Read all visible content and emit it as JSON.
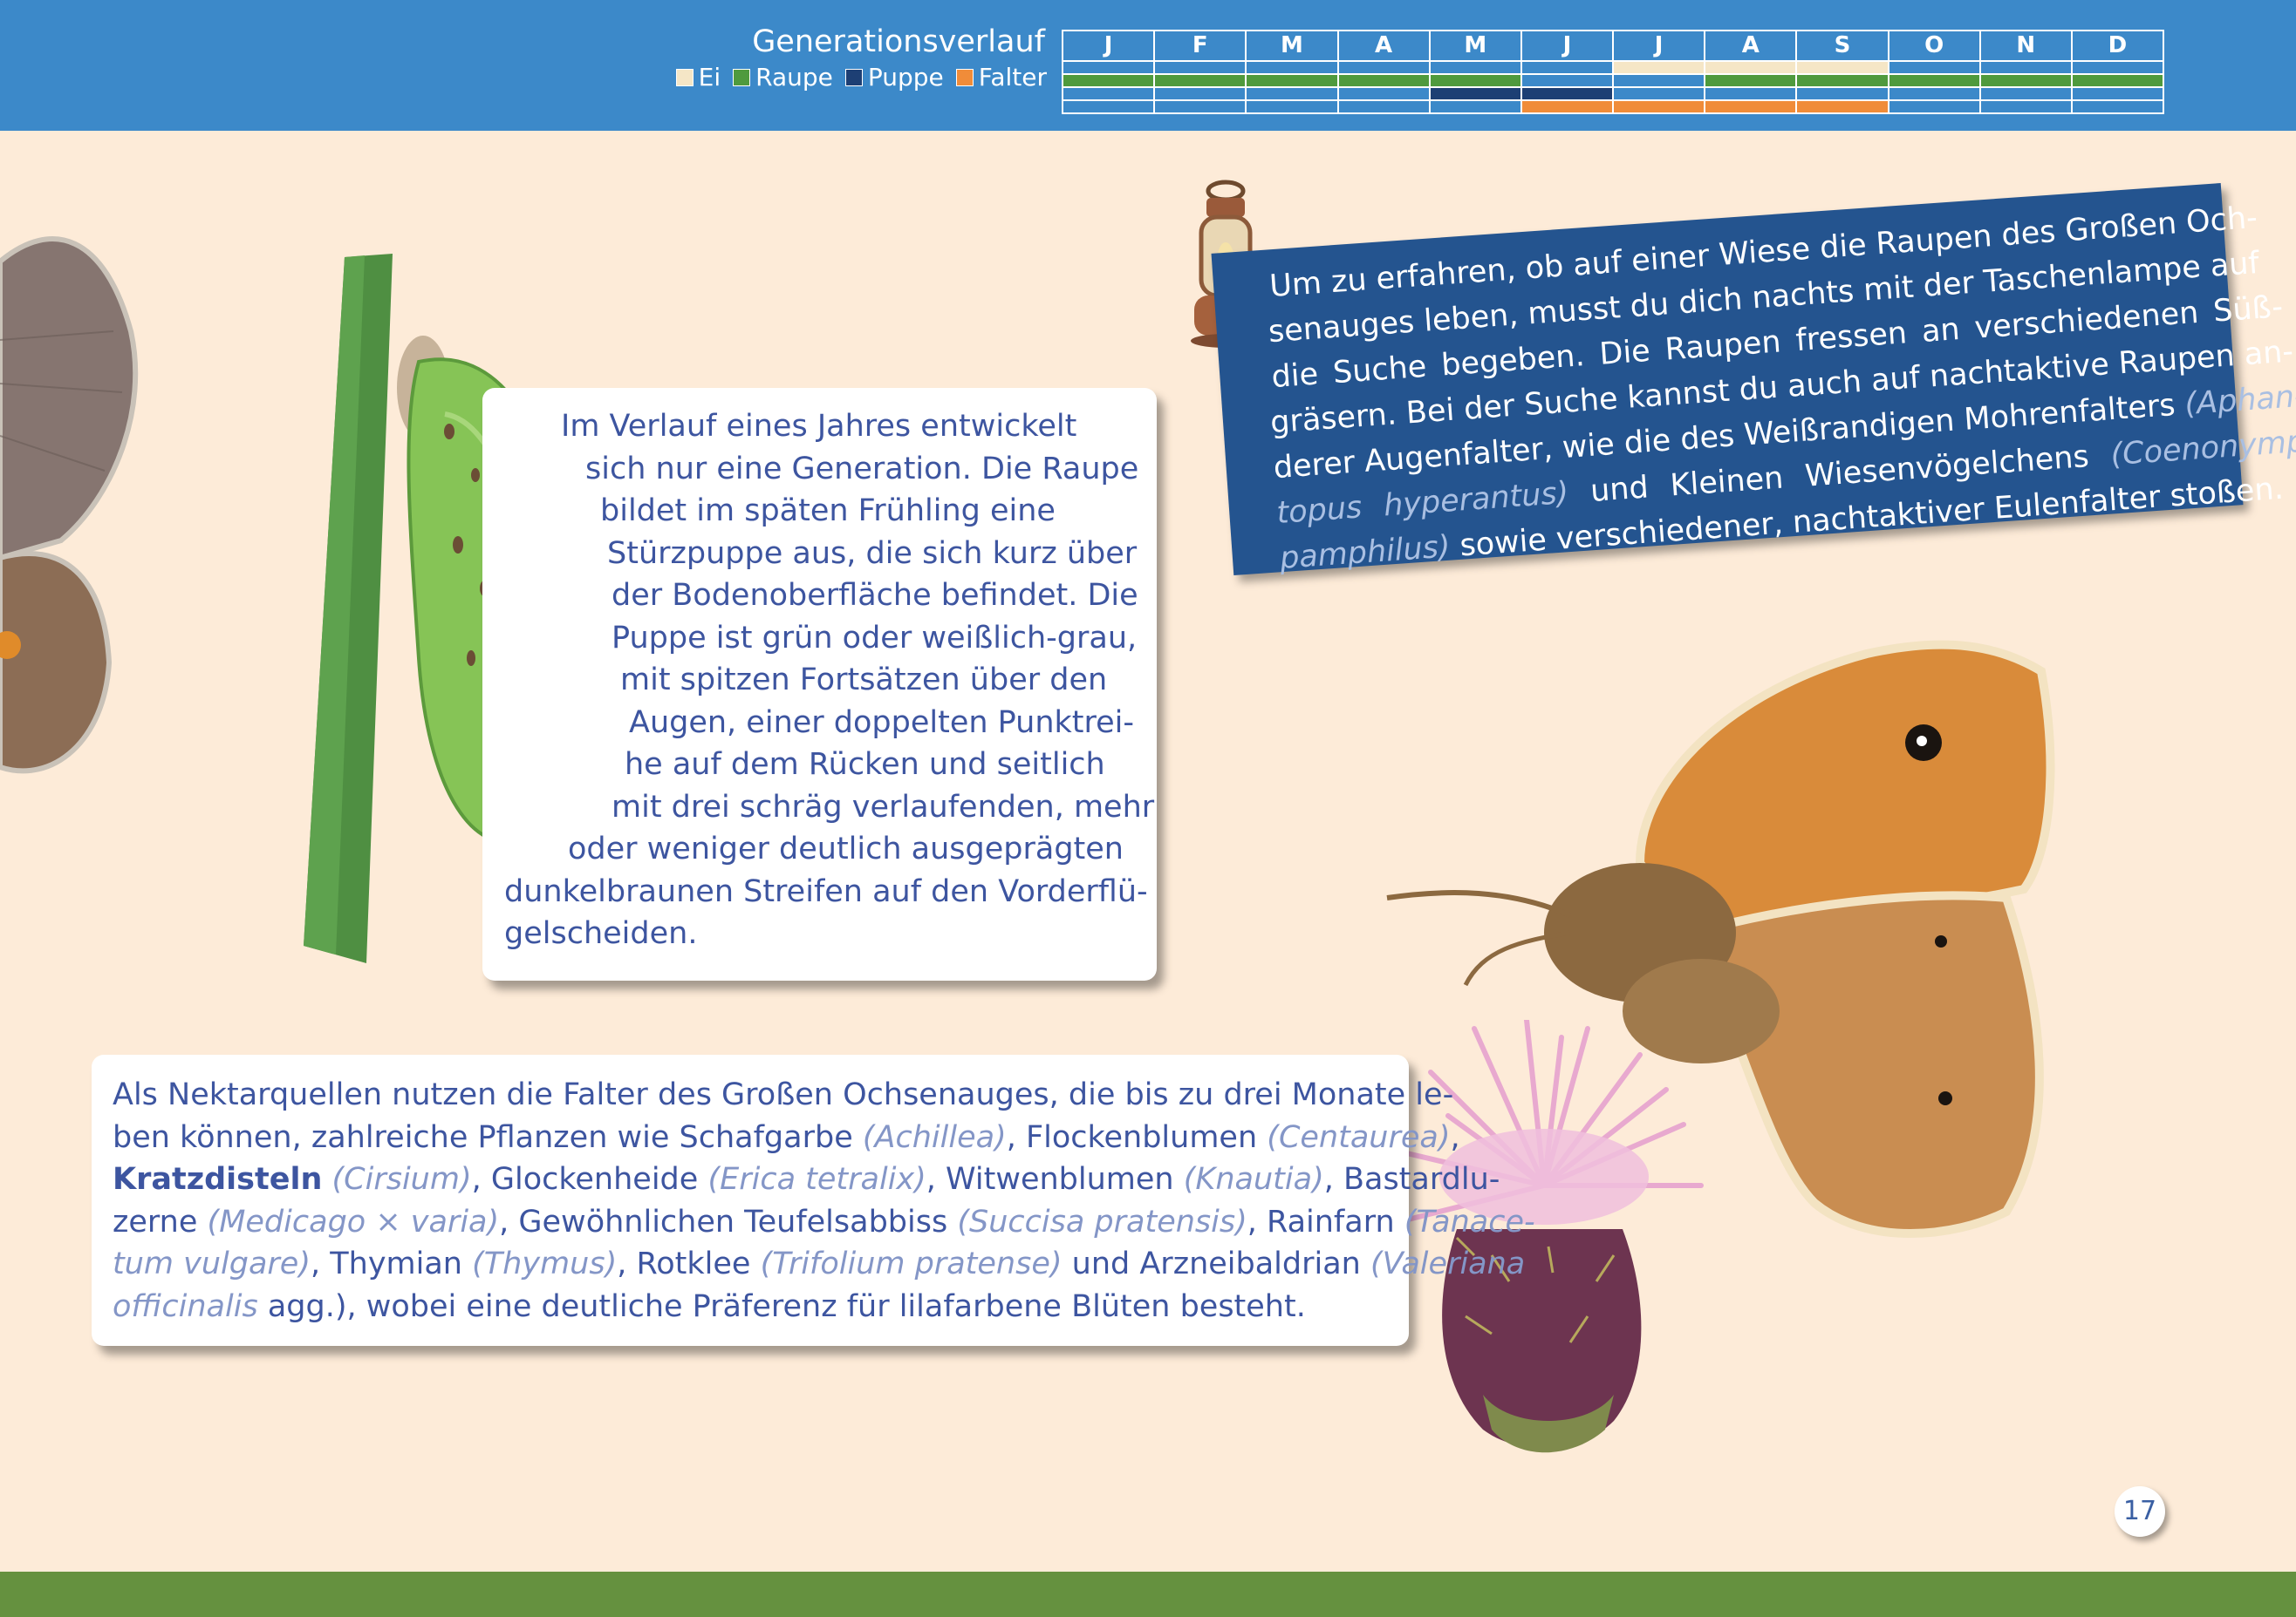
{
  "header": {
    "title": "Generationsverlauf",
    "legend": [
      {
        "label": "Ei",
        "color": "#f5e6c6"
      },
      {
        "label": "Raupe",
        "color": "#4f9a3d"
      },
      {
        "label": "Puppe",
        "color": "#1d3f74"
      },
      {
        "label": "Falter",
        "color": "#f08c39"
      }
    ],
    "months": [
      "J",
      "F",
      "M",
      "A",
      "M",
      "J",
      "J",
      "A",
      "S",
      "O",
      "N",
      "D"
    ],
    "rows": {
      "ei": [
        0,
        0,
        0,
        0,
        0,
        0,
        1,
        1,
        1,
        0,
        0,
        0
      ],
      "raupe": [
        1,
        1,
        1,
        1,
        1,
        0,
        0,
        1,
        1,
        1,
        1,
        1
      ],
      "puppe": [
        0,
        0,
        0,
        0,
        1,
        1,
        0,
        0,
        0,
        0,
        0,
        0
      ],
      "falter": [
        0,
        0,
        0,
        0,
        0,
        1,
        1,
        1,
        1,
        0,
        0,
        0
      ]
    },
    "empty_color": "#3c89c9"
  },
  "pupa_text": [
    "Im Verlauf eines Jahres entwickelt",
    "sich nur eine Generation. Die Raupe",
    "bildet im späten Frühling eine",
    "Stürzpuppe aus, die sich kurz über",
    "der Bodenoberfläche befindet. Die",
    "Puppe ist grün oder weißlich-grau,",
    "mit spitzen Fortsätzen über den",
    "Augen, einer doppelten Punktrei-",
    "he auf dem Rücken und seitlich",
    "mit drei schräg verlaufenden, mehr",
    "oder weniger deutlich ausgeprägten",
    "dunkelbraunen Streifen auf den Vorderflü-",
    "gelscheiden."
  ],
  "banner": {
    "l1": "Um zu erfahren, ob auf einer Wiese die Raupen des Großen Och-",
    "l2": "senauges leben, musst du dich nachts mit der Taschenlampe auf",
    "l3": "die Suche begeben. Die Raupen fressen an verschiedenen Süß-",
    "l4": "gräsern. Bei der Suche kannst du auch auf nachtaktive Raupen an-",
    "l5a": "derer Augenfalter, wie die des Weißrandigen Mohrenfalters",
    "l5b": "(Aphan-",
    "l6a": "topus hyperantus)",
    "l6b": "und Kleinen Wiesenvögelchens",
    "l6c": "(Coenonympha",
    "l7a": "pamphilus)",
    "l7b": "sowie verschiedener, nachtaktiver Eulenfalter stoßen."
  },
  "nectar": {
    "l1": "Als Nektarquellen nutzen die Falter des Großen Ochsenauges, die bis zu drei Monate le-",
    "l2a": "ben können, zahlreiche Pflanzen wie Schafgarbe",
    "l2b": "(Achillea)",
    "l2c": ", Flockenblumen",
    "l2d": "(Centaurea)",
    "l2e": ",",
    "l3a": "Kratzdisteln",
    "l3b": "(Cirsium)",
    "l3c": ", Glockenheide",
    "l3d": "(Erica tetralix)",
    "l3e": ", Witwenblumen",
    "l3f": "(Knautia)",
    "l3g": ", Bastardlu-",
    "l4a": "zerne",
    "l4b": "(Medicago × varia)",
    "l4c": ", Gewöhnlichen Teufelsabbiss",
    "l4d": "(Succisa pratensis)",
    "l4e": ", Rainfarn",
    "l4f": "(Tanace-",
    "l5a": "tum vulgare)",
    "l5b": ", Thymian",
    "l5c": "(Thymus)",
    "l5d": ", Rotklee",
    "l5e": "(Trifolium pratense)",
    "l5f": "und Arzneibaldrian",
    "l5g": "(Valeriana",
    "l6a": "officinalis",
    "l6b": "agg.)",
    "l6c": ", wobei eine deutliche Präferenz für lilafarbene Blüten besteht."
  },
  "page_number": "17"
}
